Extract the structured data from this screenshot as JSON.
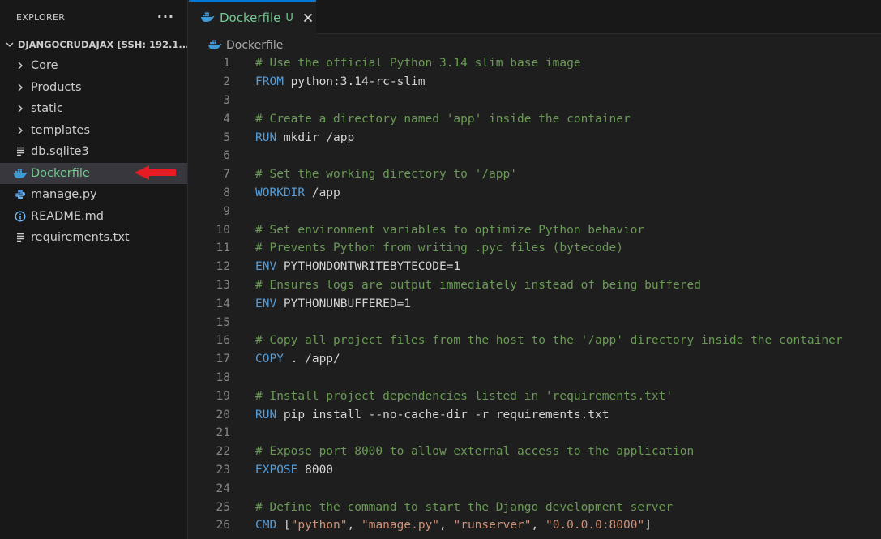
{
  "explorer": {
    "title": "EXPLORER",
    "more_label": "···",
    "root_label": "DJANGOCRUDAJAX [SSH: 192.1...",
    "items": [
      {
        "label": "Core",
        "icon": "chevron-right-icon"
      },
      {
        "label": "Products",
        "icon": "chevron-right-icon"
      },
      {
        "label": "static",
        "icon": "chevron-right-icon"
      },
      {
        "label": "templates",
        "icon": "chevron-right-icon"
      },
      {
        "label": "db.sqlite3",
        "icon": "file-lines-icon"
      },
      {
        "label": "Dockerfile",
        "icon": "docker-icon",
        "active": true
      },
      {
        "label": "manage.py",
        "icon": "python-icon"
      },
      {
        "label": "README.md",
        "icon": "info-icon"
      },
      {
        "label": "requirements.txt",
        "icon": "file-lines-icon"
      }
    ]
  },
  "tab": {
    "label": "Dockerfile",
    "badge": "U"
  },
  "breadcrumb": {
    "label": "Dockerfile"
  },
  "colors": {
    "accent": "#0078d4",
    "untracked": "#73c991",
    "comment": "#6a9955",
    "keyword": "#569cd6",
    "string": "#ce9178",
    "annotation_arrow": "#e51c23"
  },
  "code_lines": [
    {
      "n": "1",
      "type": "comment",
      "text": "# Use the official Python 3.14 slim base image"
    },
    {
      "n": "2",
      "type": "instr",
      "kw": "FROM",
      "rest": " python:3.14-rc-slim"
    },
    {
      "n": "3",
      "type": "blank"
    },
    {
      "n": "4",
      "type": "comment",
      "text": "# Create a directory named 'app' inside the container"
    },
    {
      "n": "5",
      "type": "instr",
      "kw": "RUN",
      "rest": " mkdir /app"
    },
    {
      "n": "6",
      "type": "blank"
    },
    {
      "n": "7",
      "type": "comment",
      "text": "# Set the working directory to '/app'"
    },
    {
      "n": "8",
      "type": "instr",
      "kw": "WORKDIR",
      "rest": " /app"
    },
    {
      "n": "9",
      "type": "blank"
    },
    {
      "n": "10",
      "type": "comment",
      "text": "# Set environment variables to optimize Python behavior"
    },
    {
      "n": "11",
      "type": "comment",
      "text": "# Prevents Python from writing .pyc files (bytecode)"
    },
    {
      "n": "12",
      "type": "instr",
      "kw": "ENV",
      "rest": " PYTHONDONTWRITEBYTECODE=1"
    },
    {
      "n": "13",
      "type": "comment",
      "text": "# Ensures logs are output immediately instead of being buffered"
    },
    {
      "n": "14",
      "type": "instr",
      "kw": "ENV",
      "rest": " PYTHONUNBUFFERED=1"
    },
    {
      "n": "15",
      "type": "blank"
    },
    {
      "n": "16",
      "type": "comment",
      "text": "# Copy all project files from the host to the '/app' directory inside the container"
    },
    {
      "n": "17",
      "type": "instr",
      "kw": "COPY",
      "rest": " . /app/"
    },
    {
      "n": "18",
      "type": "blank"
    },
    {
      "n": "19",
      "type": "comment",
      "text": "# Install project dependencies listed in 'requirements.txt'"
    },
    {
      "n": "20",
      "type": "instr",
      "kw": "RUN",
      "rest": " pip install --no-cache-dir -r requirements.txt"
    },
    {
      "n": "21",
      "type": "blank"
    },
    {
      "n": "22",
      "type": "comment",
      "text": "# Expose port 8000 to allow external access to the application"
    },
    {
      "n": "23",
      "type": "instr",
      "kw": "EXPOSE",
      "rest": " 8000"
    },
    {
      "n": "24",
      "type": "blank"
    },
    {
      "n": "25",
      "type": "comment",
      "text": "# Define the command to start the Django development server"
    },
    {
      "n": "26",
      "type": "cmd",
      "kw": "CMD",
      "tokens": [
        " [",
        "\"python\"",
        ", ",
        "\"manage.py\"",
        ", ",
        "\"runserver\"",
        ", ",
        "\"0.0.0.0:8000\"",
        "]"
      ]
    }
  ]
}
